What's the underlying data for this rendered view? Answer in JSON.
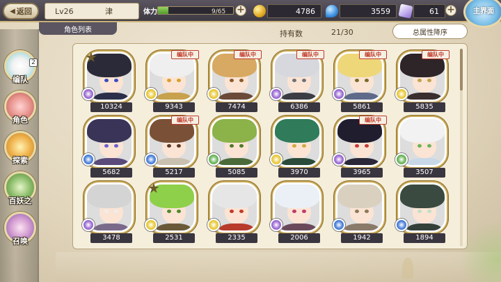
{
  "header": {
    "back_label": "返回",
    "level": "Lv26",
    "player_name": "津",
    "stamina_label": "体力",
    "stamina_value": "9/65",
    "stamina_fraction": 0.14,
    "gold": "4786",
    "magatama": "3559",
    "gems": "61",
    "main_menu_label": "主界面"
  },
  "list": {
    "tab_label": "角色列表",
    "own_label": "持有数",
    "own_count": "21/30",
    "sort_label": "总属性降序"
  },
  "sidebar": {
    "items": [
      {
        "label": "编队",
        "icon": "team-icon",
        "badge": "2"
      },
      {
        "label": "角色",
        "icon": "character-icon"
      },
      {
        "label": "探索",
        "icon": "explore-icon"
      },
      {
        "label": "百妖之",
        "icon": "yokai-book-icon"
      },
      {
        "label": "召唤",
        "icon": "summon-icon"
      }
    ]
  },
  "cards": [
    {
      "power": "10324",
      "in_team": false,
      "starred": true,
      "hair": "#2a2a38",
      "eye": "#3b4cc2",
      "elem": "#9b6bd3",
      "outfit": "#2c2f4a"
    },
    {
      "power": "9343",
      "in_team": true,
      "starred": false,
      "hair": "#efefef",
      "eye": "#d9a02c",
      "elem": "#e8c93c",
      "outfit": "#c8a14d"
    },
    {
      "power": "7474",
      "in_team": true,
      "starred": false,
      "hair": "#d8a962",
      "eye": "#8a5a2a",
      "elem": "#e8c93c",
      "outfit": "#6b4a3a"
    },
    {
      "power": "6386",
      "in_team": true,
      "starred": false,
      "hair": "#d7d7de",
      "eye": "#6f6f78",
      "elem": "#9b6bd3",
      "outfit": "#3c3c44"
    },
    {
      "power": "5861",
      "in_team": true,
      "starred": false,
      "hair": "#eed779",
      "eye": "#7b6b2a",
      "elem": "#9b6bd3",
      "outfit": "#5e6a8a"
    },
    {
      "power": "5835",
      "in_team": true,
      "starred": false,
      "hair": "#2e2528",
      "eye": "#c1a24a",
      "elem": "#e8c93c",
      "outfit": "#3a2e2e"
    },
    {
      "power": "5682",
      "in_team": false,
      "starred": false,
      "hair": "#3a3458",
      "eye": "#6c5fd2",
      "elem": "#4a7fd8",
      "outfit": "#5a4a7a"
    },
    {
      "power": "5217",
      "in_team": true,
      "starred": false,
      "hair": "#7a5136",
      "eye": "#5a3a2a",
      "elem": "#4a7fd8",
      "outfit": "#c9c0b0"
    },
    {
      "power": "5085",
      "in_team": false,
      "starred": false,
      "hair": "#8cb24a",
      "eye": "#4e7a2a",
      "elem": "#6ab45a",
      "outfit": "#4b6a3a"
    },
    {
      "power": "3970",
      "in_team": false,
      "starred": false,
      "hair": "#2f7b5a",
      "eye": "#d6a73c",
      "elem": "#e8c93c",
      "outfit": "#2a4a3a"
    },
    {
      "power": "3965",
      "in_team": true,
      "starred": false,
      "hair": "#1f1d2e",
      "eye": "#c93a3a",
      "elem": "#9b6bd3",
      "outfit": "#2a2838"
    },
    {
      "power": "3507",
      "in_team": false,
      "starred": false,
      "hair": "#f2f2f2",
      "eye": "#6ab45a",
      "elem": "#6ab45a",
      "outfit": "#c8d8e8"
    },
    {
      "power": "3478",
      "in_team": false,
      "starred": false,
      "hair": "#d4d4d4",
      "eye": "#eeeeee",
      "elem": "#9b6bd3",
      "outfit": "#7a6a8a"
    },
    {
      "power": "2531",
      "in_team": false,
      "starred": true,
      "hair": "#8fd04a",
      "eye": "#4e8a2a",
      "elem": "#e8c93c",
      "outfit": "#6a5a3a"
    },
    {
      "power": "2335",
      "in_team": false,
      "starred": false,
      "hair": "#e6e6e6",
      "eye": "#c23a2a",
      "elem": "#e8c93c",
      "outfit": "#b83a2a"
    },
    {
      "power": "2006",
      "in_team": false,
      "starred": false,
      "hair": "#eaf0f6",
      "eye": "#c23a6a",
      "elem": "#9b6bd3",
      "outfit": "#6a4a5a"
    },
    {
      "power": "1942",
      "in_team": false,
      "starred": false,
      "hair": "#d9d0c0",
      "eye": "#8a7a5a",
      "elem": "#4a7fd8",
      "outfit": "#8a7a6a"
    },
    {
      "power": "1894",
      "in_team": false,
      "starred": false,
      "hair": "#3a4a40",
      "eye": "#bfe0c8",
      "elem": "#4a7fd8",
      "outfit": "#34403a"
    }
  ],
  "in_team_label": "编队中"
}
